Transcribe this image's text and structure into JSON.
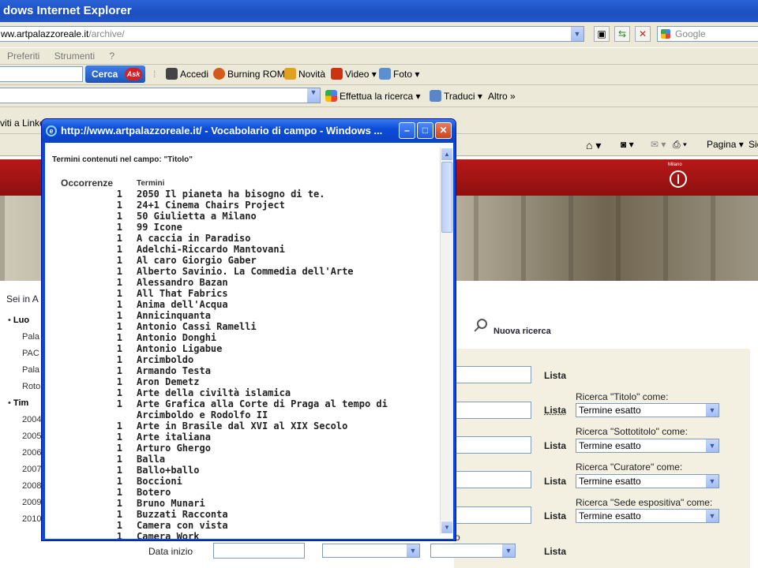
{
  "browser": {
    "title": "dows Internet Explorer",
    "address_domain": "ww.artpalazzoreale.it",
    "address_path": "/archive/",
    "search_placeholder": "Google",
    "menu": [
      "Preferiti",
      "Strumenti",
      "?"
    ],
    "ask_button": "Cerca",
    "ask_logo": "Ask",
    "toolbar1": [
      "Accedi",
      "Burning ROM",
      "Novità",
      "Video ▾",
      "Foto ▾"
    ],
    "toolbar2": [
      "Effettua la ricerca ▾",
      "Traduci ▾",
      "Altro »"
    ],
    "favorites_item": "viti a Linke",
    "command_bar": [
      "Pagina ▾",
      "Sic"
    ]
  },
  "page": {
    "breadcrumb": "Sei in A",
    "nav_items": [
      "Luo",
      "Pala",
      "PAC",
      "Pala",
      "Roto",
      "Tim",
      "2004",
      "2005",
      "2006",
      "2007",
      "2008",
      "2009",
      "2010"
    ],
    "new_search": "Nuova ricerca",
    "list_label": "Lista",
    "search_rows": [
      {
        "label": "Ricerca \"Titolo\" come:",
        "value": "Termine esatto"
      },
      {
        "label": "Ricerca \"Sottotitolo\" come:",
        "value": "Termine esatto"
      },
      {
        "label": "Ricerca \"Curatore\" come:",
        "value": "Termine esatto"
      },
      {
        "label": "Ricerca \"Sede espositiva\" come:",
        "value": "Termine esatto"
      }
    ],
    "date_start": "Data inizio",
    "partial_label": "o",
    "banner_text": "Milano"
  },
  "popup": {
    "title": "http://www.artpalazzoreale.it/ - Vocabolario di campo - Windows ...",
    "header": "Termini contenuti nel campo: \"Titolo\"",
    "col_occ": "Occorrenze",
    "col_term": "Termini",
    "rows": [
      [
        "1",
        "2050 Il pianeta ha bisogno di te."
      ],
      [
        "1",
        "24+1 Cinema Chairs Project"
      ],
      [
        "1",
        "50 Giulietta a Milano"
      ],
      [
        "1",
        "99 Icone"
      ],
      [
        "1",
        "A caccia in Paradiso"
      ],
      [
        "1",
        "Adelchi-Riccardo Mantovani"
      ],
      [
        "1",
        "Al caro Giorgio Gaber"
      ],
      [
        "1",
        "Alberto Savinio. La Commedia dell'Arte"
      ],
      [
        "1",
        "Alessandro Bazan"
      ],
      [
        "1",
        "All That Fabrics"
      ],
      [
        "1",
        "Anima dell'Acqua"
      ],
      [
        "1",
        "Annicinquanta"
      ],
      [
        "1",
        "Antonio Cassi Ramelli"
      ],
      [
        "1",
        "Antonio Donghi"
      ],
      [
        "1",
        "Antonio Ligabue"
      ],
      [
        "1",
        "Arcimboldo"
      ],
      [
        "1",
        "Armando Testa"
      ],
      [
        "1",
        "Aron Demetz"
      ],
      [
        "1",
        "Arte della civiltà islamica"
      ],
      [
        "1",
        "Arte Grafica alla Corte di Praga al tempo di Arcimboldo e Rodolfo II"
      ],
      [
        "1",
        "Arte in Brasile dal XVI al XIX Secolo"
      ],
      [
        "1",
        "Arte italiana"
      ],
      [
        "1",
        "Arturo Ghergo"
      ],
      [
        "1",
        "Balla"
      ],
      [
        "1",
        "Ballo+ballo"
      ],
      [
        "1",
        "Boccioni"
      ],
      [
        "1",
        "Botero"
      ],
      [
        "1",
        "Bruno Munari"
      ],
      [
        "1",
        "Buzzati Racconta"
      ],
      [
        "1",
        "Camera con vista"
      ],
      [
        "1",
        "Camera Work"
      ]
    ]
  }
}
